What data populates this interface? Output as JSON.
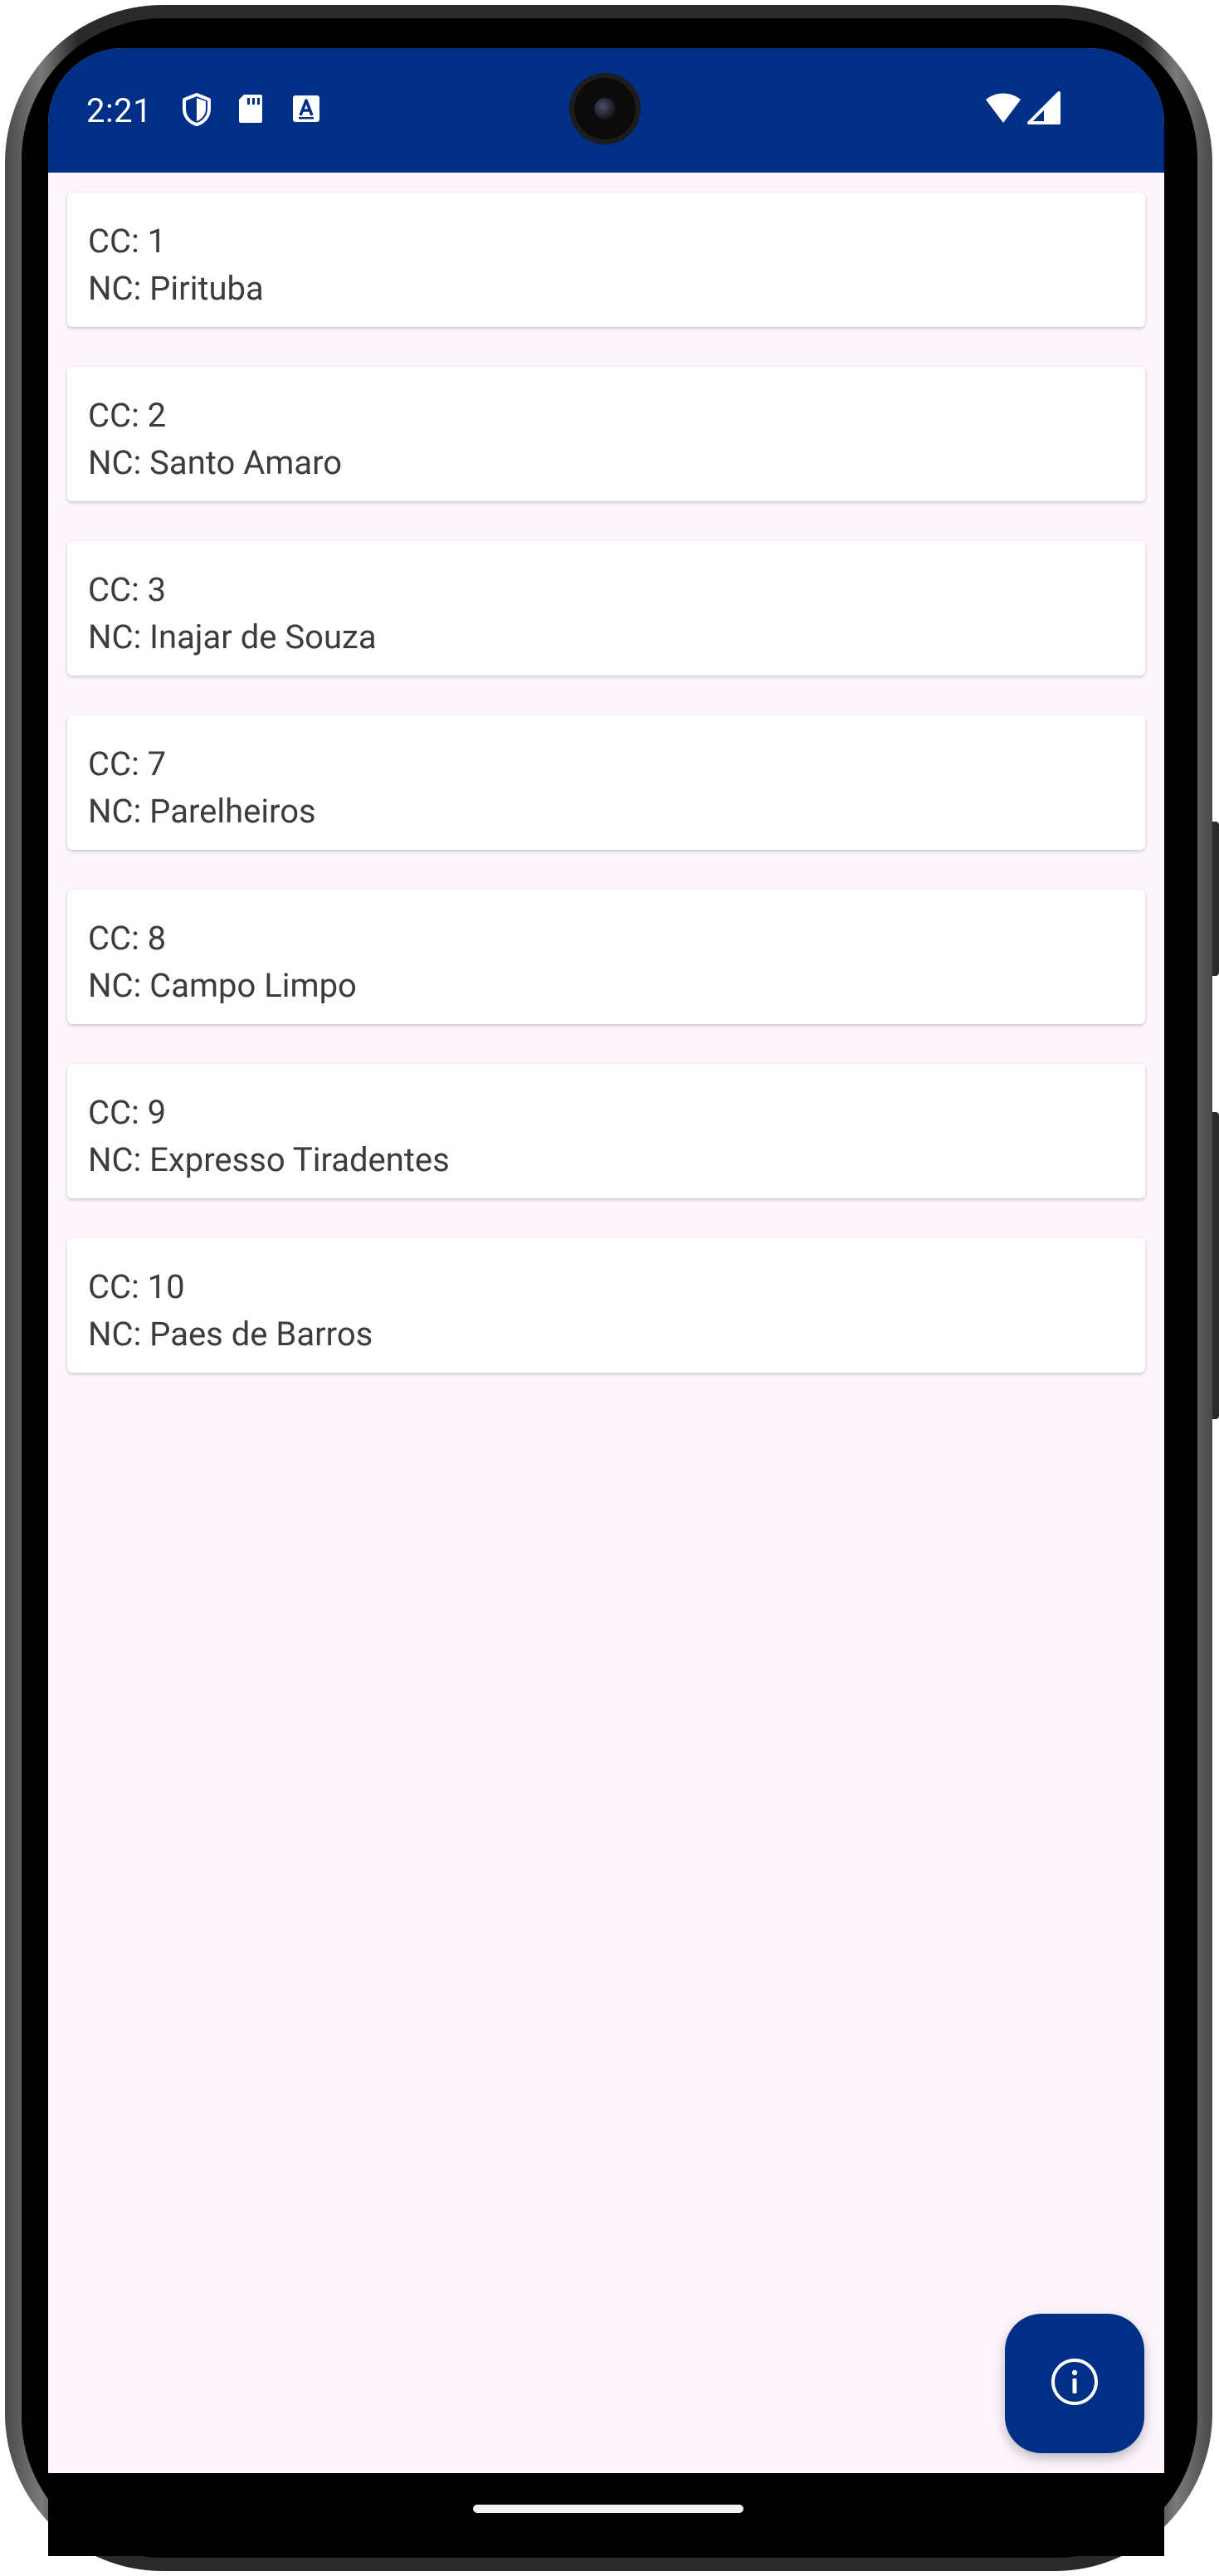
{
  "status_bar": {
    "time": "2:21",
    "icons_left": [
      "shield-icon",
      "sd-card-icon",
      "text-a-icon"
    ],
    "icons_right": [
      "wifi-icon",
      "signal-icon"
    ],
    "background_color": "#022f86"
  },
  "list": {
    "items": [
      {
        "cc": "CC: 1",
        "nc": "NC: Pirituba"
      },
      {
        "cc": "CC: 2",
        "nc": "NC: Santo Amaro"
      },
      {
        "cc": "CC: 3",
        "nc": "NC: Inajar de Souza"
      },
      {
        "cc": "CC: 7",
        "nc": "NC: Parelheiros"
      },
      {
        "cc": "CC: 8",
        "nc": "NC: Campo Limpo"
      },
      {
        "cc": "CC: 9",
        "nc": "NC: Expresso Tiradentes"
      },
      {
        "cc": "CC: 10",
        "nc": "NC: Paes de Barros"
      }
    ]
  },
  "fab": {
    "icon": "info-icon",
    "color": "#022f86"
  },
  "theme": {
    "background": "#fcf6fc",
    "card": "#ffffff",
    "text": "#3c3c3c"
  }
}
